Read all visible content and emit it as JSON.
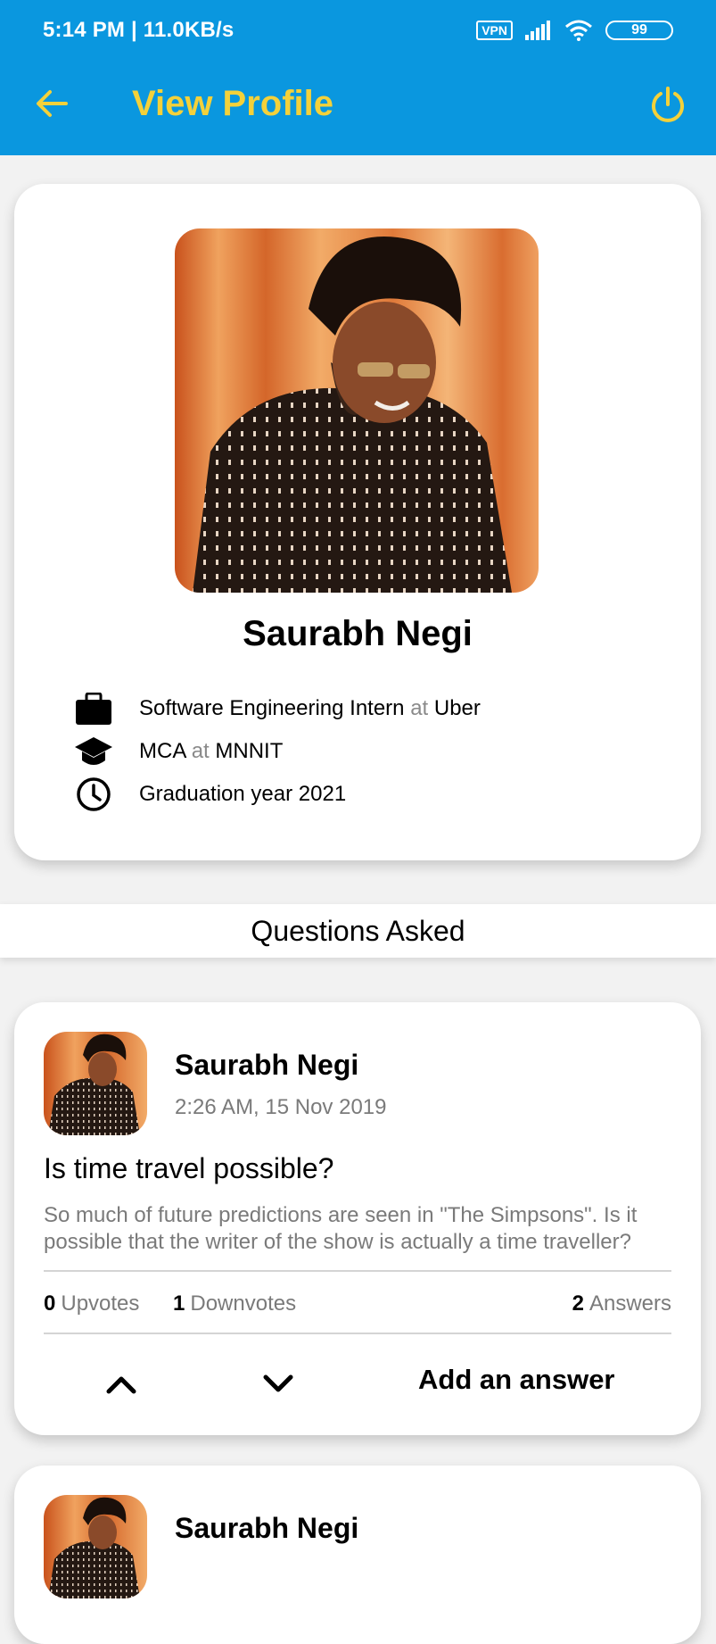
{
  "status_bar": {
    "time": "5:14 PM | 11.0KB/s",
    "vpn": "VPN",
    "battery": "99"
  },
  "toolbar": {
    "title": "View Profile",
    "back_icon": "arrow-back-icon",
    "power_icon": "power-icon",
    "title_color": "#f4d13a",
    "background_color": "#0a97df"
  },
  "profile": {
    "name": "Saurabh Negi",
    "work": {
      "role": "Software Engineering Intern",
      "at": "at",
      "company": "Uber",
      "icon": "briefcase-icon"
    },
    "education": {
      "degree": "MCA",
      "at": "at",
      "institute": "MNNIT",
      "icon": "graduation-cap-icon"
    },
    "graduation": {
      "label": "Graduation year",
      "year": "2021",
      "icon": "clock-icon"
    }
  },
  "section": {
    "title": "Questions Asked"
  },
  "questions": [
    {
      "author": "Saurabh Negi",
      "time": "2:26 AM, 15 Nov 2019",
      "title": "Is time travel possible?",
      "body": "So much of future predictions are seen in \"The Simpsons\". Is it possible that the writer of the show is actually a time traveller?",
      "upvotes": "0",
      "upvotes_label": "Upvotes",
      "downvotes": "1",
      "downvotes_label": "Downvotes",
      "answers": "2",
      "answers_label": "Answers",
      "add_answer_label": "Add an answer"
    },
    {
      "author": "Saurabh Negi"
    }
  ]
}
